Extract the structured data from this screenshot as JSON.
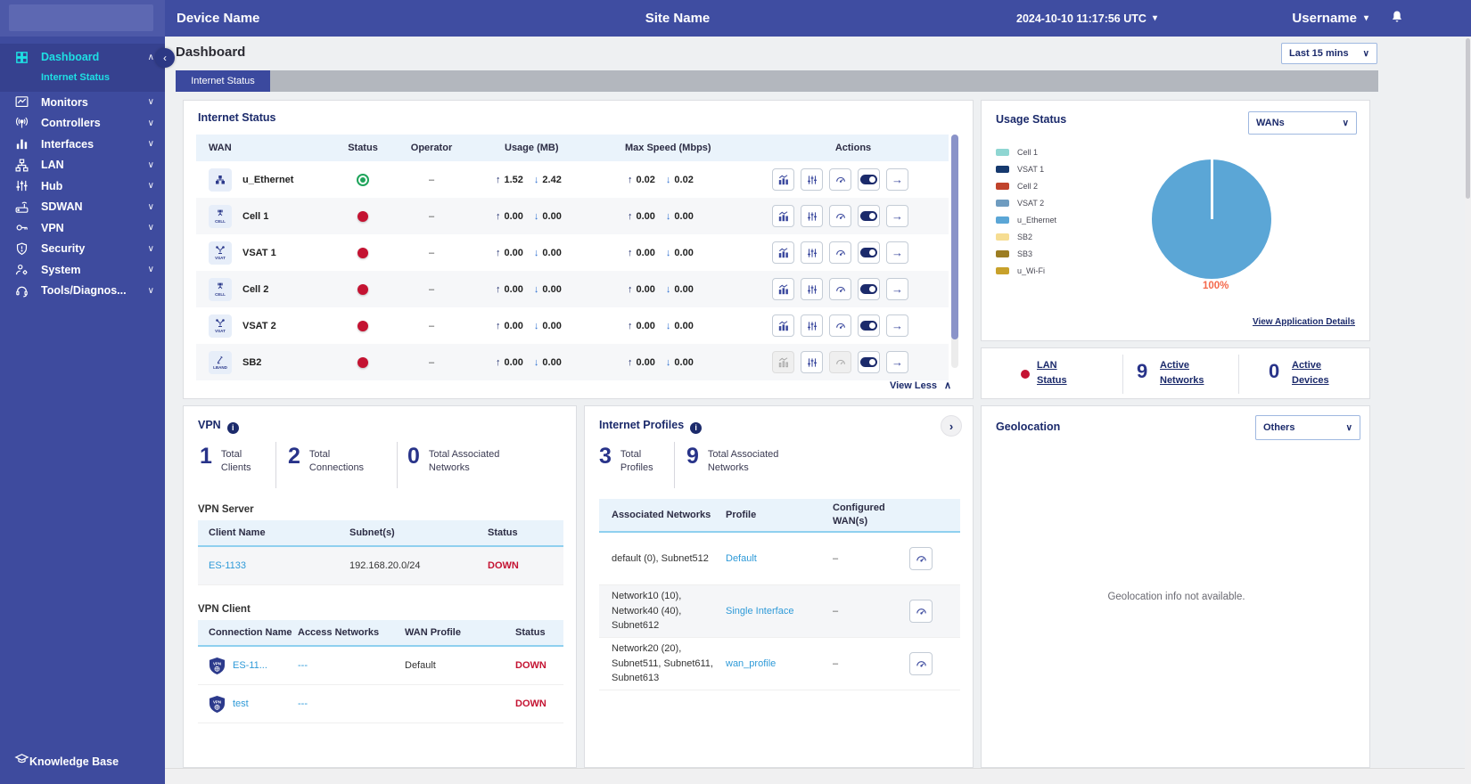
{
  "topbar": {
    "device_name": "Device Name",
    "site_name": "Site Name",
    "timestamp": "2024-10-10 11:17:56 UTC",
    "username": "Username"
  },
  "sidebar": {
    "dashboard": "Dashboard",
    "internet_status": "Internet Status",
    "items": [
      "Monitors",
      "Controllers",
      "Interfaces",
      "LAN",
      "Hub",
      "SDWAN",
      "VPN",
      "Security",
      "System",
      "Tools/Diagnos..."
    ],
    "knowledge_base": "Knowledge Base"
  },
  "page": {
    "title": "Dashboard",
    "time_range": "Last 15 mins",
    "tab": "Internet Status"
  },
  "internet_status": {
    "title": "Internet Status",
    "col_wan": "WAN",
    "col_status": "Status",
    "col_operator": "Operator",
    "col_usage": "Usage (MB)",
    "col_speed": "Max Speed (Mbps)",
    "col_actions": "Actions",
    "view_less": "View Less",
    "rows": [
      {
        "name": "u_Ethernet",
        "badge": "",
        "status": "connected",
        "operator": "–",
        "usage_up": "1.52",
        "usage_down": "2.42",
        "speed_up": "0.02",
        "speed_down": "0.02"
      },
      {
        "name": "Cell 1",
        "badge": "CELL",
        "status": "disconnected",
        "operator": "–",
        "usage_up": "0.00",
        "usage_down": "0.00",
        "speed_up": "0.00",
        "speed_down": "0.00"
      },
      {
        "name": "VSAT 1",
        "badge": "VSAT",
        "status": "disconnected",
        "operator": "–",
        "usage_up": "0.00",
        "usage_down": "0.00",
        "speed_up": "0.00",
        "speed_down": "0.00"
      },
      {
        "name": "Cell 2",
        "badge": "CELL",
        "status": "disconnected",
        "operator": "–",
        "usage_up": "0.00",
        "usage_down": "0.00",
        "speed_up": "0.00",
        "speed_down": "0.00"
      },
      {
        "name": "VSAT 2",
        "badge": "VSAT",
        "status": "disconnected",
        "operator": "–",
        "usage_up": "0.00",
        "usage_down": "0.00",
        "speed_up": "0.00",
        "speed_down": "0.00"
      },
      {
        "name": "SB2",
        "badge": "LBAND",
        "status": "disconnected",
        "operator": "–",
        "usage_up": "0.00",
        "usage_down": "0.00",
        "speed_up": "0.00",
        "speed_down": "0.00"
      }
    ]
  },
  "usage_status": {
    "title": "Usage Status",
    "filter": "WANs",
    "link": "View Application Details",
    "legend": [
      {
        "label": "Cell 1",
        "color": "#8fd6d2"
      },
      {
        "label": "VSAT 1",
        "color": "#16396e"
      },
      {
        "label": "Cell 2",
        "color": "#c0432c"
      },
      {
        "label": "VSAT 2",
        "color": "#6f9cc0"
      },
      {
        "label": "u_Ethernet",
        "color": "#5ba6d6"
      },
      {
        "label": "SB2",
        "color": "#f6dd92"
      },
      {
        "label": "SB3",
        "color": "#9c7d22"
      },
      {
        "label": "u_Wi-Fi",
        "color": "#c8a12b"
      }
    ],
    "chart_data": {
      "type": "pie",
      "title": "Usage Status",
      "categories": [
        "Cell 1",
        "VSAT 1",
        "Cell 2",
        "VSAT 2",
        "u_Ethernet",
        "SB2",
        "SB3",
        "u_Wi-Fi"
      ],
      "values": [
        0,
        0,
        0,
        0,
        100,
        0,
        0,
        0
      ],
      "center_label": "100%",
      "slice_color": "#5ba6d6",
      "label_color": "#f4694c",
      "legend_position": "left"
    }
  },
  "lan_summary": {
    "status_label": "LAN Status",
    "networks_value": "9",
    "networks_label": "Active Networks",
    "devices_value": "0",
    "devices_label": "Active Devices"
  },
  "vpn": {
    "title": "VPN",
    "stats": {
      "clients": {
        "value": "1",
        "label": "Total Clients"
      },
      "connections": {
        "value": "2",
        "label": "Total Connections"
      },
      "associated": {
        "value": "0",
        "label": "Total Associated Networks"
      }
    },
    "server": {
      "title": "VPN Server",
      "col_client": "Client Name",
      "col_subnets": "Subnet(s)",
      "col_status": "Status",
      "rows": [
        {
          "client": "ES-1133",
          "subnets": "192.168.20.0/24",
          "status": "DOWN"
        }
      ]
    },
    "client": {
      "title": "VPN Client",
      "col_name": "Connection Name",
      "col_access": "Access Networks",
      "col_profile": "WAN Profile",
      "col_status": "Status",
      "rows": [
        {
          "name": "ES-11...",
          "access": "---",
          "profile": "Default",
          "status": "DOWN"
        },
        {
          "name": "test",
          "access": "---",
          "profile": "",
          "status": "DOWN"
        }
      ]
    }
  },
  "internet_profiles": {
    "title": "Internet Profiles",
    "stats": {
      "profiles": {
        "value": "3",
        "label": "Total Profiles"
      },
      "associated": {
        "value": "9",
        "label": "Total Associated Networks"
      }
    },
    "col_networks": "Associated Networks",
    "col_profile": "Profile",
    "col_wans": "Configured WAN(s)",
    "rows": [
      {
        "networks": "default (0), Subnet512",
        "profile": "Default",
        "wans": "–"
      },
      {
        "networks": "Network10 (10), Network40 (40), Subnet612",
        "profile": "Single Interface",
        "wans": "–"
      },
      {
        "networks": "Network20 (20), Subnet511, Subnet611, Subnet613",
        "profile": "wan_profile",
        "wans": "–"
      }
    ]
  },
  "geolocation": {
    "title": "Geolocation",
    "filter": "Others",
    "empty_message": "Geolocation info not available."
  }
}
